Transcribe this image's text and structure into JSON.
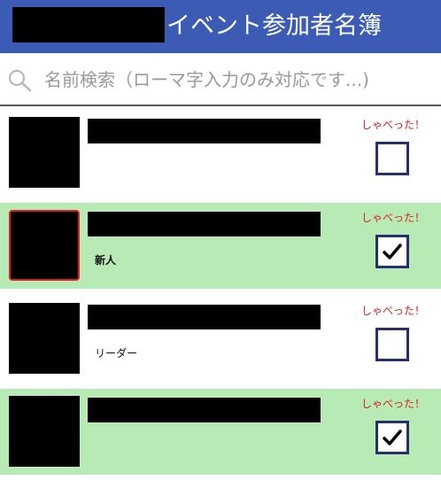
{
  "header": {
    "title": "イベント参加者名簿"
  },
  "search": {
    "placeholder": "名前検索（ローマ字入力のみ対応です...)",
    "value": ""
  },
  "participants": [
    {
      "role": "",
      "spoke_label": "しゃべった！",
      "spoke": false,
      "highlight": false
    },
    {
      "role": "新人",
      "spoke_label": "しゃべった！",
      "spoke": true,
      "highlight": true
    },
    {
      "role": "リーダー",
      "spoke_label": "しゃべった！",
      "spoke": false,
      "highlight": false
    },
    {
      "role": "",
      "spoke_label": "しゃべった！",
      "spoke": true,
      "highlight": false
    }
  ],
  "colors": {
    "header_bg": "#3b5bb5",
    "row_highlight_bg": "#b7eab5",
    "spoke_label": "#e02020",
    "checkbox_border": "#26316b",
    "avatar_highlight_border": "#e02020"
  },
  "icons": {
    "search": "magnifier-icon",
    "check": "checkmark-icon"
  }
}
